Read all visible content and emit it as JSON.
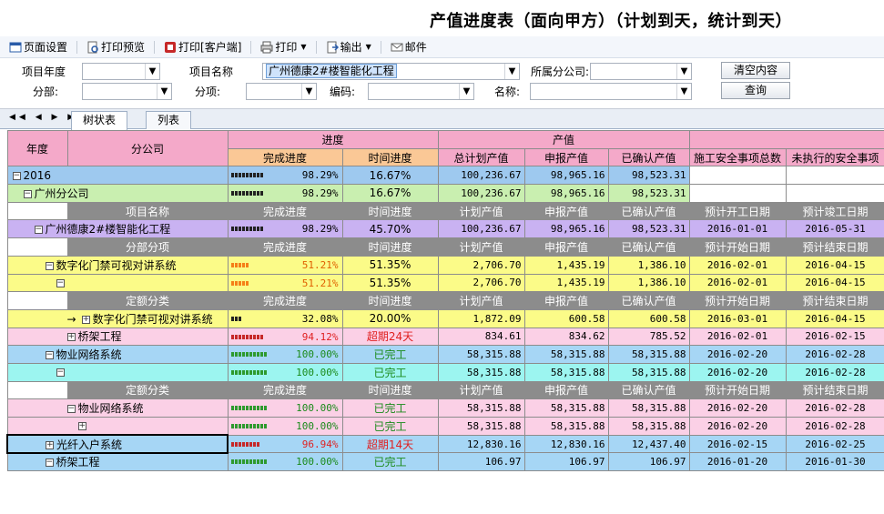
{
  "title": "产值进度表（面向甲方）（计划到天，统计到天）",
  "toolbar": {
    "page_setup": "页面设置",
    "print_preview": "打印预览",
    "print_client": "打印[客户端]",
    "print": "打印",
    "export": "输出",
    "mail": "邮件"
  },
  "filters": {
    "year_label": "项目年度",
    "year_value": "",
    "project_label": "项目名称",
    "project_value": "广州德康2#楼智能化工程",
    "branch_label": "所属分公司:",
    "branch_value": "",
    "clear_button": "清空内容",
    "division_label": "分部:",
    "division_value": "",
    "item_label": "分项:",
    "item_value": "",
    "code_label": "编码:",
    "code_value": "",
    "name_label": "名称:",
    "name_value": "",
    "query_button": "查询"
  },
  "tabs": {
    "nav": "◀◀ ◀ ▶ ▶▶",
    "tree": "树状表",
    "list": "列表"
  },
  "header": {
    "year": "年度",
    "branch": "分公司",
    "progress": "进度",
    "value": "产值",
    "done_progress": "完成进度",
    "time_progress": "时间进度",
    "total_plan": "总计划产值",
    "reported": "申报产值",
    "confirmed": "已确认产值",
    "safety_total": "施工安全事项总数",
    "safety_pending": "未执行的安全事项"
  },
  "sub_headers": {
    "project": [
      "项目名称",
      "完成进度",
      "时间进度",
      "计划产值",
      "申报产值",
      "已确认产值",
      "预计开工日期",
      "预计竣工日期"
    ],
    "division": [
      "分部分项",
      "完成进度",
      "时间进度",
      "计划产值",
      "申报产值",
      "已确认产值",
      "预计开始日期",
      "预计结束日期"
    ],
    "quota": [
      "定额分类",
      "完成进度",
      "时间进度",
      "计划产值",
      "申报产值",
      "已确认产值",
      "预计开始日期",
      "预计结束日期"
    ]
  },
  "rows": [
    {
      "kind": "year",
      "label": "2016",
      "progress": "98.29%",
      "bar": 9,
      "barColor": "#222222",
      "time": "16.67%",
      "total": "100,236.67",
      "reported": "98,965.16",
      "confirmed": "98,523.31",
      "c1": "",
      "c2": "",
      "bg": "#9ec9ef"
    },
    {
      "kind": "branch",
      "label": "广州分公司",
      "progress": "98.29%",
      "bar": 9,
      "barColor": "#222222",
      "time": "16.67%",
      "total": "100,236.67",
      "reported": "98,965.16",
      "confirmed": "98,523.31",
      "c1": "",
      "c2": "",
      "bg": "#c9efb0"
    },
    {
      "kind": "sub",
      "set": "project"
    },
    {
      "kind": "project",
      "label": "广州德康2#楼智能化工程",
      "progress": "98.29%",
      "bar": 9,
      "barColor": "#222222",
      "time": "45.70%",
      "total": "100,236.67",
      "reported": "98,965.16",
      "confirmed": "98,523.31",
      "c1": "2016-01-01",
      "c2": "2016-05-31",
      "bg": "#c9b2f2"
    },
    {
      "kind": "sub",
      "set": "division"
    },
    {
      "kind": "div",
      "label": "数字化门禁可视对讲系统",
      "progress": "51.21%",
      "progressColor": "#e06000",
      "bar": 5,
      "barColor": "#f57f17",
      "time": "51.35%",
      "total": "2,706.70",
      "reported": "1,435.19",
      "confirmed": "1,386.10",
      "c1": "2016-02-01",
      "c2": "2016-04-15",
      "bg": "#fbfb88"
    },
    {
      "kind": "div2",
      "label": "",
      "progress": "51.21%",
      "progressColor": "#e06000",
      "bar": 5,
      "barColor": "#f57f17",
      "time": "51.35%",
      "total": "2,706.70",
      "reported": "1,435.19",
      "confirmed": "1,386.10",
      "c1": "2016-02-01",
      "c2": "2016-04-15",
      "bg": "#fbfb88"
    },
    {
      "kind": "sub",
      "set": "quota"
    },
    {
      "kind": "quota",
      "label": "数字化门禁可视对讲系统",
      "arrow": "→",
      "progress": "32.08%",
      "bar": 3,
      "barColor": "#222222",
      "time": "20.00%",
      "total": "1,872.09",
      "reported": "600.58",
      "confirmed": "600.58",
      "c1": "2016-03-01",
      "c2": "2016-04-15",
      "bg": "#fbfb88"
    },
    {
      "kind": "quota2",
      "label": "桥架工程",
      "progress": "94.12%",
      "progressColor": "#e02020",
      "bar": 9,
      "barColor": "#c62828",
      "time": "超期24天",
      "timeColor": "#e02020",
      "total": "834.61",
      "reported": "834.62",
      "confirmed": "785.52",
      "c1": "2016-02-01",
      "c2": "2016-02-15",
      "bg": "#fbd0e6"
    },
    {
      "kind": "div",
      "label": "物业网络系统",
      "progress": "100.00%",
      "progressColor": "#1a8a1a",
      "bar": 10,
      "barColor": "#2e9a2e",
      "time": "已完工",
      "timeColor": "#1a8a1a",
      "total": "58,315.88",
      "reported": "58,315.88",
      "confirmed": "58,315.88",
      "c1": "2016-02-20",
      "c2": "2016-02-28",
      "bg": "#a6d6f5"
    },
    {
      "kind": "div2",
      "label": "",
      "progress": "100.00%",
      "progressColor": "#1a8a1a",
      "bar": 10,
      "barColor": "#2e9a2e",
      "time": "已完工",
      "timeColor": "#1a8a1a",
      "total": "58,315.88",
      "reported": "58,315.88",
      "confirmed": "58,315.88",
      "c1": "2016-02-20",
      "c2": "2016-02-28",
      "bg": "#9cf5f0"
    },
    {
      "kind": "sub",
      "set": "quota"
    },
    {
      "kind": "quota3",
      "label": "物业网络系统",
      "progress": "100.00%",
      "progressColor": "#1a8a1a",
      "bar": 10,
      "barColor": "#2e9a2e",
      "time": "已完工",
      "timeColor": "#1a8a1a",
      "total": "58,315.88",
      "reported": "58,315.88",
      "confirmed": "58,315.88",
      "c1": "2016-02-20",
      "c2": "2016-02-28",
      "bg": "#fbd0e6"
    },
    {
      "kind": "quota4",
      "label": "",
      "progress": "100.00%",
      "progressColor": "#1a8a1a",
      "bar": 10,
      "barColor": "#2e9a2e",
      "time": "已完工",
      "timeColor": "#1a8a1a",
      "total": "58,315.88",
      "reported": "58,315.88",
      "confirmed": "58,315.88",
      "c1": "2016-02-20",
      "c2": "2016-02-28",
      "bg": "#fbd0e6"
    },
    {
      "kind": "div",
      "label": "光纤入户系统",
      "progress": "96.94%",
      "progressColor": "#e02020",
      "bar": 8,
      "barColor": "#c62828",
      "time": "超期14天",
      "timeColor": "#e02020",
      "total": "12,830.16",
      "reported": "12,830.16",
      "confirmed": "12,437.40",
      "c1": "2016-02-15",
      "c2": "2016-02-25",
      "bg": "#a6d6f5",
      "selected": true
    },
    {
      "kind": "div",
      "label": "桥架工程",
      "progress": "100.00%",
      "progressColor": "#1a8a1a",
      "bar": 10,
      "barColor": "#2e9a2e",
      "time": "已完工",
      "timeColor": "#1a8a1a",
      "total": "106.97",
      "reported": "106.97",
      "confirmed": "106.97",
      "c1": "2016-01-20",
      "c2": "2016-01-30",
      "bg": "#a6d6f5"
    }
  ]
}
